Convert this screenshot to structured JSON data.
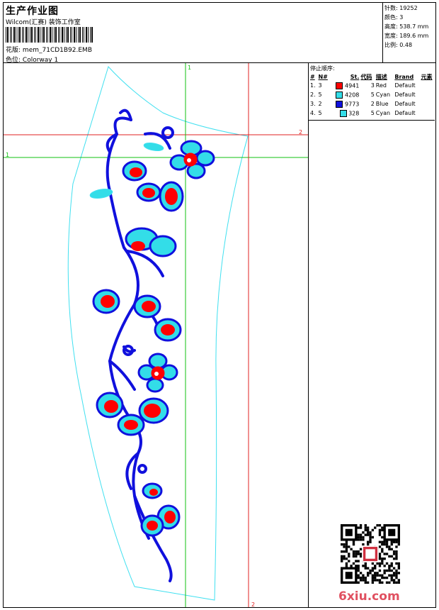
{
  "header": {
    "title": "生产作业图",
    "company": "Wilcom(汇赛) 装饰工作室",
    "design_label": "花版:",
    "design_value": "mem_71CD1B92.EMB",
    "colorway_label": "色位:",
    "colorway_value": "Colorway 1"
  },
  "specs": [
    {
      "label": "针数:",
      "value": "19252"
    },
    {
      "label": "颜色:",
      "value": "3"
    },
    {
      "label": "高度:",
      "value": "538.7 mm"
    },
    {
      "label": "宽度:",
      "value": "189.6 mm"
    },
    {
      "label": "比例:",
      "value": "0.48"
    }
  ],
  "stop_sequence": {
    "title": "停止顺序:",
    "columns": [
      "#",
      "N#",
      "St.",
      "代码",
      "描述",
      "Brand",
      "元素"
    ],
    "rows": [
      {
        "idx": "1.",
        "n": "3",
        "color": "#ff0000",
        "st": "4941",
        "code": "3",
        "desc": "Red",
        "brand": "Default"
      },
      {
        "idx": "2.",
        "n": "5",
        "color": "#33dde8",
        "st": "4208",
        "code": "5",
        "desc": "Cyan",
        "brand": "Default"
      },
      {
        "idx": "3.",
        "n": "2",
        "color": "#1010dd",
        "st": "9773",
        "code": "2",
        "desc": "Blue",
        "brand": "Default"
      },
      {
        "idx": "4.",
        "n": "5",
        "color": "#33dde8",
        "st": "328",
        "code": "5",
        "desc": "Cyan",
        "brand": "Default"
      }
    ]
  },
  "guides": {
    "h1": "1",
    "h2": "2",
    "v1": "1",
    "v2": "2"
  },
  "watermark": "6xiu.com",
  "colors": {
    "red": "#ff0000",
    "cyan": "#33dde8",
    "blue": "#1010dd",
    "guide_red": "#e02020",
    "guide_green": "#10c010"
  }
}
